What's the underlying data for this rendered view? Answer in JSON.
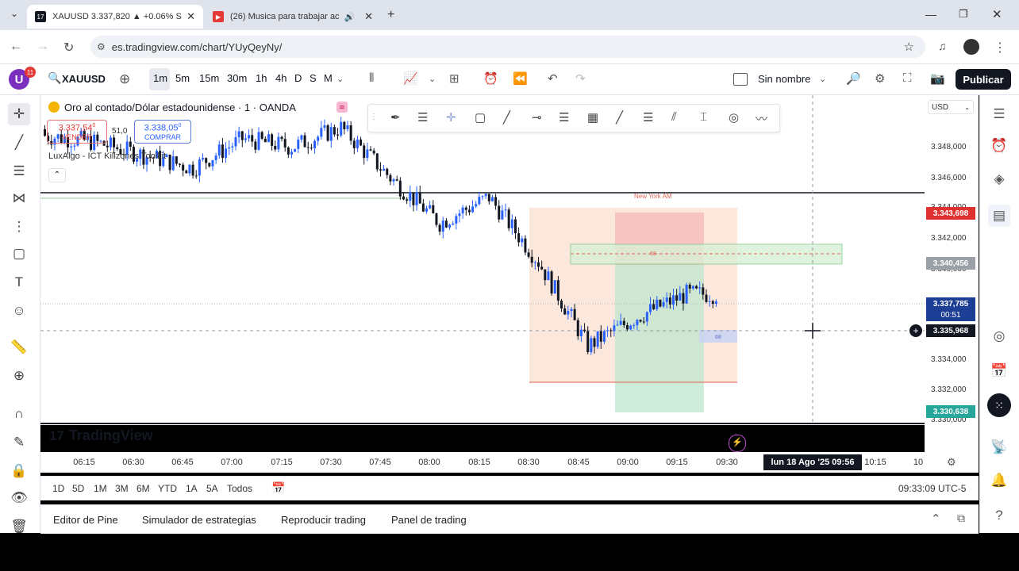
{
  "browser": {
    "tabs": [
      {
        "title": "XAUUSD 3.337,820 ▲ +0.06% S",
        "active": true
      },
      {
        "title": "(26) Musica para trabajar ac",
        "active": false
      }
    ],
    "url": "es.tradingview.com/chart/YUyQeyNy/"
  },
  "toolbar": {
    "avatar_badge": "11",
    "symbol": "XAUUSD",
    "timeframes": [
      "1m",
      "5m",
      "15m",
      "30m",
      "1h",
      "4h",
      "D",
      "S",
      "M"
    ],
    "layout_name": "Sin nombre",
    "publish_label": "Publicar"
  },
  "chart": {
    "title": "Oro al contado/Dólar estadounidense · 1 · OANDA",
    "sell_price": "3.337,54",
    "sell_sup": "0",
    "sell_label": "VENDER",
    "spread": "51,0",
    "buy_price": "3.338,05",
    "buy_sup": "0",
    "buy_label": "COMPRAR",
    "indicator": "LuxAlgo - ICT Killzones Toolkit",
    "session_label": "New York AM",
    "zone_label": "68",
    "zone_label2": "68",
    "currency": "USD",
    "watermark": "TradingView"
  },
  "price_scale": {
    "labels": [
      "3.348,000",
      "3.346,000",
      "3.344,000",
      "3.342,000",
      "3.340,000",
      "3.334,000",
      "3.332,000",
      "3.330,000"
    ],
    "tags": [
      {
        "text": "3.343,698",
        "color": "#e03131"
      },
      {
        "text": "3.340,456",
        "color": "#9aa0a6"
      },
      {
        "text": "3.337,785",
        "color": "#1c3f95"
      },
      {
        "text": "00:51",
        "color": "#1c3f95"
      },
      {
        "text": "3.335,968",
        "color": "#131722"
      },
      {
        "text": "3.330,638",
        "color": "#26a69a"
      }
    ]
  },
  "time_scale": {
    "labels": [
      "06:15",
      "06:30",
      "06:45",
      "07:00",
      "07:15",
      "07:30",
      "07:45",
      "08:00",
      "08:15",
      "08:30",
      "08:45",
      "09:00",
      "09:15",
      "09:30",
      "10:15",
      "10"
    ],
    "crosshair_label": "lun 18 Ago '25   09:56"
  },
  "range_bar": {
    "ranges": [
      "1D",
      "5D",
      "1M",
      "3M",
      "6M",
      "YTD",
      "1A",
      "5A",
      "Todos"
    ],
    "clock": "09:33:09 UTC-5"
  },
  "bottom_panel": {
    "tabs": [
      "Editor de Pine",
      "Simulador de estrategias",
      "Reproducir trading",
      "Panel de trading"
    ]
  },
  "chart_data": {
    "type": "candlestick",
    "x": [
      "06:15",
      "06:30",
      "06:45",
      "07:00",
      "07:15",
      "07:30",
      "07:45",
      "08:00",
      "08:15",
      "08:30",
      "08:45",
      "09:00",
      "09:15",
      "09:30"
    ],
    "close": [
      3347.6,
      3347.2,
      3346.4,
      3345.6,
      3347.4,
      3346.9,
      3348.1,
      3345.0,
      3342.2,
      3343.8,
      3339.8,
      3334.6,
      3336.4,
      3337.8
    ],
    "high": [
      3348.2,
      3347.9,
      3347.1,
      3346.3,
      3348.0,
      3347.6,
      3348.6,
      3345.4,
      3342.8,
      3344.0,
      3341.1,
      3337.3,
      3337.3,
      3338.1
    ],
    "low": [
      3346.9,
      3346.4,
      3345.6,
      3345.0,
      3346.6,
      3346.2,
      3347.0,
      3343.8,
      3341.2,
      3341.7,
      3337.8,
      3332.6,
      3333.8,
      3335.6
    ],
    "ylim": [
      3329.8,
      3350.2
    ]
  }
}
